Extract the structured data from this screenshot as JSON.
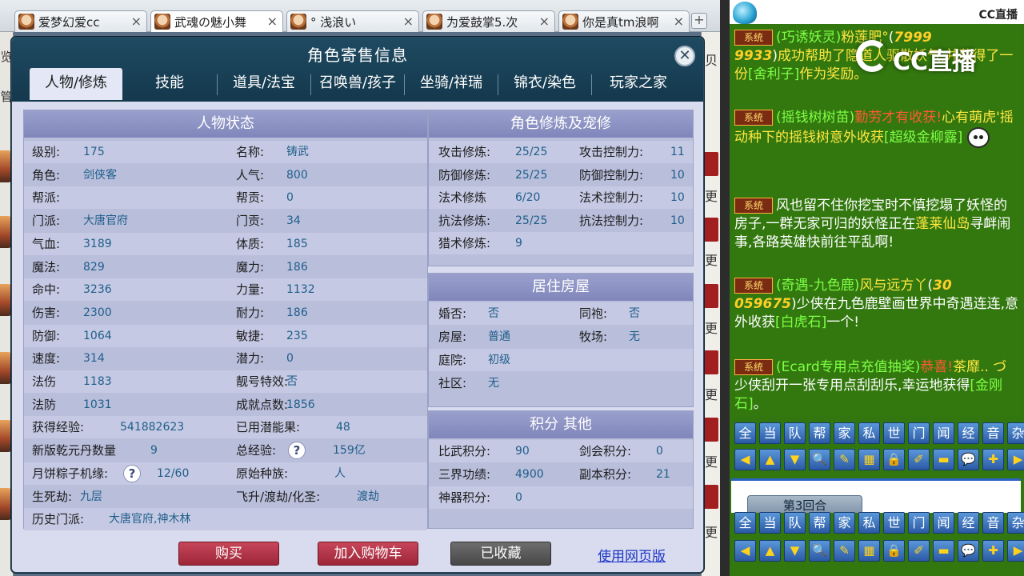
{
  "browser": {
    "tabs": [
      {
        "label": "爱梦幻爱cc",
        "active": false
      },
      {
        "label": "武魂の魅小舞",
        "active": true
      },
      {
        "label": "° 浅浪い",
        "active": false
      },
      {
        "label": "为爱鼓掌5.次",
        "active": false
      },
      {
        "label": "你是真tm浪啊",
        "active": false
      }
    ],
    "close_glyph": "×",
    "new_tab_glyph": "+"
  },
  "side_left": {
    "chars": [
      "览",
      "管"
    ]
  },
  "side_right": {
    "chars": [
      "贝",
      "更",
      "更",
      "更",
      "更",
      "更",
      "更",
      "更",
      "贝",
      "更"
    ]
  },
  "dialog": {
    "title": "角色寄售信息",
    "close_glyph": "✕",
    "tabs": [
      "人物/修炼",
      "技能",
      "道具/法宝",
      "召唤兽/孩子",
      "坐骑/祥瑞",
      "锦衣/染色",
      "玩家之家"
    ],
    "active_tab": "人物/修炼",
    "status": {
      "title": "人物状态",
      "rows": [
        {
          "l1": "级别:",
          "v1": "175",
          "l2": "名称:",
          "v2": "铸武"
        },
        {
          "l1": "角色:",
          "v1": "剑侠客",
          "l2": "人气:",
          "v2": "800"
        },
        {
          "l1": "帮派:",
          "v1": "",
          "l2": "帮贡:",
          "v2": "0"
        },
        {
          "l1": "门派:",
          "v1": "大唐官府",
          "l2": "门贡:",
          "v2": "34"
        },
        {
          "l1": "气血:",
          "v1": "3189",
          "l2": "体质:",
          "v2": "185"
        },
        {
          "l1": "魔法:",
          "v1": "829",
          "l2": "魔力:",
          "v2": "186"
        },
        {
          "l1": "命中:",
          "v1": "3236",
          "l2": "力量:",
          "v2": "1132"
        },
        {
          "l1": "伤害:",
          "v1": "2300",
          "l2": "耐力:",
          "v2": "186"
        },
        {
          "l1": "防御:",
          "v1": "1064",
          "l2": "敏捷:",
          "v2": "235"
        },
        {
          "l1": "速度:",
          "v1": "314",
          "l2": "潜力:",
          "v2": "0"
        },
        {
          "l1": "法伤",
          "v1": "1183",
          "l2": "靓号特效:",
          "v2": "否"
        },
        {
          "l1": "法防",
          "v1": "1031",
          "l2": "成就点数:",
          "v2": "1856"
        },
        {
          "l1": "获得经验:",
          "v1": "541882623",
          "l2": "已用潜能果:",
          "v2": "48"
        },
        {
          "l1": "新版乾元丹数量",
          "v1": "9",
          "l2": "总经验:",
          "v2": "159亿"
        },
        {
          "l1": "月饼粽子机缘:",
          "v1": "12/60",
          "l2": "原始种族:",
          "v2": "人"
        },
        {
          "l1": "生死劫:",
          "v1": "九层",
          "l2": "飞升/渡劫/化圣:",
          "v2": "渡劫"
        },
        {
          "l1": "历史门派:",
          "v1": "大唐官府,神木林",
          "l2": "",
          "v2": ""
        }
      ],
      "help_glyph": "?"
    },
    "cultivation": {
      "title": "角色修炼及宠修",
      "rows": [
        {
          "l1": "攻击修炼:",
          "v1": "25/25",
          "l2": "攻击控制力:",
          "v2": "11"
        },
        {
          "l1": "防御修炼:",
          "v1": "25/25",
          "l2": "防御控制力:",
          "v2": "10"
        },
        {
          "l1": "法术修炼",
          "v1": "6/20",
          "l2": "法术控制力:",
          "v2": "10"
        },
        {
          "l1": "抗法修炼:",
          "v1": "25/25",
          "l2": "抗法控制力:",
          "v2": "10"
        },
        {
          "l1": "猎术修炼:",
          "v1": "9",
          "l2": "",
          "v2": ""
        }
      ]
    },
    "house": {
      "title": "居住房屋",
      "rows": [
        {
          "l1": "婚否:",
          "v1": "否",
          "l2": "同袍:",
          "v2": "否"
        },
        {
          "l1": "房屋:",
          "v1": "普通",
          "l2": "牧场:",
          "v2": "无"
        },
        {
          "l1": "庭院:",
          "v1": "初级",
          "l2": "",
          "v2": ""
        },
        {
          "l1": "社区:",
          "v1": "无",
          "l2": "",
          "v2": ""
        }
      ]
    },
    "points": {
      "title": "积分 其他",
      "rows": [
        {
          "l1": "比武积分:",
          "v1": "90",
          "l2": "剑会积分:",
          "v2": "0"
        },
        {
          "l1": "三界功绩:",
          "v1": "4900",
          "l2": "副本积分:",
          "v2": "21"
        },
        {
          "l1": "神器积分:",
          "v1": "0",
          "l2": "",
          "v2": ""
        }
      ]
    },
    "buttons": {
      "buy": "购买",
      "cart": "加入购物车",
      "collected": "已收藏",
      "web": "使用网页版"
    }
  },
  "chat": {
    "logo_small": "CC直播",
    "logo_big": "CC直播",
    "sys_tag": "系统",
    "m1": {
      "name": "(巧诱妖灵)",
      "player": "粉莲肥°",
      "num": "7999",
      "num2": "9933",
      "text": "成功帮助了隐道人驱散妖气,并获得了一份",
      "item": "[舍利子]",
      "tail": "作为奖励。"
    },
    "m2": {
      "name": "(摇钱树树苗)",
      "hl": "勤劳才有收获!",
      "p1": "心有萌虎'",
      "text": "摇动种下的摇钱树意外收获",
      "item": "[超级金柳露]"
    },
    "m3": {
      "text1": "风也留不住你",
      "text2": "挖宝时不慎挖塌了妖怪的房子,一群无家可归的妖怪正在",
      "place": "蓬莱仙岛",
      "text3": "寻衅闹事,各路英雄快前往平乱啊!"
    },
    "m4": {
      "name": "(奇遇-九色鹿)",
      "player": "风与远方丫",
      "num": "30",
      "num2": "059675",
      "text": "少侠在九色鹿壁画世界中奇遇连连,意外收获",
      "item": "[白虎石]",
      "tail": "一个!"
    },
    "m5": {
      "name": "(Ecard专用点充值抽奖)",
      "hl": "恭喜!",
      "player": "茶靡.. づ",
      "text": "少侠刮开一张专用点刮刮乐,幸运地获得",
      "item": "[金刚石]",
      "tail": "。"
    },
    "channels": [
      "全",
      "当",
      "队",
      "帮",
      "家",
      "私",
      "世",
      "门",
      "闻",
      "经",
      "音",
      "杂"
    ],
    "icons": [
      "arrow-left-icon",
      "arrow-up-icon",
      "arrow-down-icon",
      "magnifier-icon",
      "note-icon",
      "grid-icon",
      "lock-icon",
      "brush-icon",
      "folder-icon",
      "speech-icon",
      "edit-icon",
      "arrow-right-icon"
    ],
    "icon_glyphs": [
      "◀",
      "▲",
      "▼",
      "🔍",
      "✎",
      "▦",
      "🔒",
      "✐",
      "▬",
      "💬",
      "✚",
      "▶"
    ],
    "round_label": "第3回合"
  }
}
